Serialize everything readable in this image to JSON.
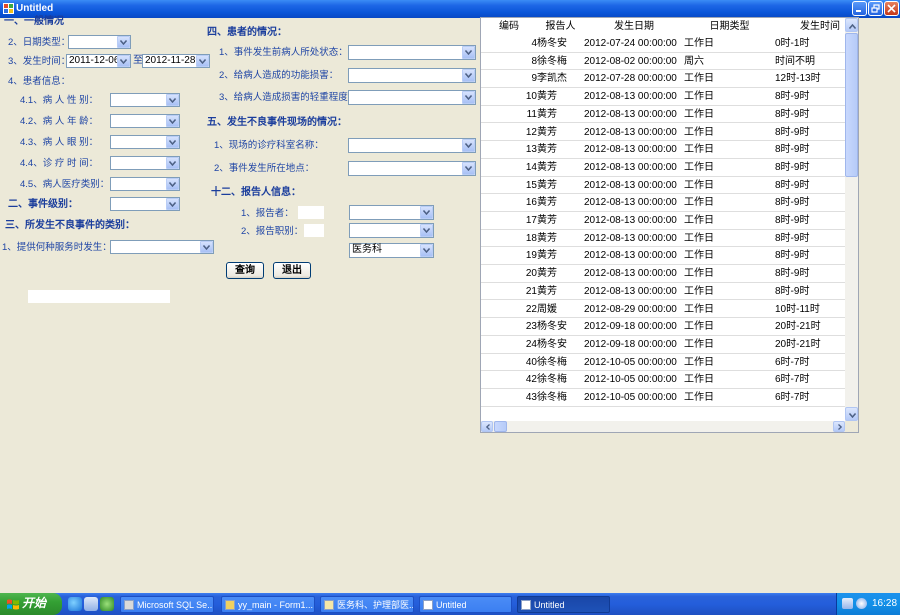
{
  "window": {
    "title": "Untitled",
    "app_icon": "app-window-icon"
  },
  "general": {
    "title": "一、一般情况",
    "date_type": {
      "label": "2、日期类型："
    },
    "occur_time": {
      "label": "3、发生时间：",
      "from": "2011-12-06",
      "sep": "至",
      "to": "2012-11-28"
    },
    "patient_info": {
      "label": "4、患者信息："
    },
    "patient_fields": [
      {
        "label": "4.1、病 人 性 别："
      },
      {
        "label": "4.2、病 人 年 龄："
      },
      {
        "label": "4.3、病 人 眼 别："
      },
      {
        "label": "4.4、诊 疗 时 间："
      },
      {
        "label": "4.5、病人医疗类别："
      }
    ]
  },
  "event_level": {
    "label": "二、事件级别："
  },
  "event_category": {
    "title": "三、所发生不良事件的类别：",
    "service": {
      "label": "1、提供何种服务时发生："
    }
  },
  "patient_status": {
    "title": "四、患者的情况：",
    "fields": [
      {
        "label": "1、事件发生前病人所处状态："
      },
      {
        "label": "2、给病人造成的功能损害："
      },
      {
        "label": "3、给病人造成损害的轻重程度："
      }
    ]
  },
  "scene": {
    "title": "五、发生不良事件现场的情况：",
    "fields": [
      {
        "label": "1、现场的诊疗科室名称："
      },
      {
        "label": "2、事件发生所在地点："
      }
    ]
  },
  "reporter": {
    "title": "十二、报告人信息：",
    "fields": [
      {
        "label": "1、报告者："
      },
      {
        "label": "2、报告职别："
      }
    ],
    "department": "医务科"
  },
  "buttons": {
    "query": "查询",
    "exit": "退出"
  },
  "grid": {
    "columns": [
      "编码",
      "报告人",
      "发生日期",
      "日期类型",
      "发生时间"
    ],
    "rows": [
      {
        "code": "4",
        "reporter": "杨冬安",
        "date": "2012-07-24 00:00:00",
        "type": "工作日",
        "time": "0时-1时"
      },
      {
        "code": "8",
        "reporter": "徐冬梅",
        "date": "2012-08-02 00:00:00",
        "type": "周六",
        "time": "时间不明"
      },
      {
        "code": "9",
        "reporter": "李凯杰",
        "date": "2012-07-28 00:00:00",
        "type": "工作日",
        "time": "12时-13时"
      },
      {
        "code": "10",
        "reporter": "黄芳",
        "date": "2012-08-13 00:00:00",
        "type": "工作日",
        "time": "8时-9时"
      },
      {
        "code": "11",
        "reporter": "黄芳",
        "date": "2012-08-13 00:00:00",
        "type": "工作日",
        "time": "8时-9时"
      },
      {
        "code": "12",
        "reporter": "黄芳",
        "date": "2012-08-13 00:00:00",
        "type": "工作日",
        "time": "8时-9时"
      },
      {
        "code": "13",
        "reporter": "黄芳",
        "date": "2012-08-13 00:00:00",
        "type": "工作日",
        "time": "8时-9时"
      },
      {
        "code": "14",
        "reporter": "黄芳",
        "date": "2012-08-13 00:00:00",
        "type": "工作日",
        "time": "8时-9时"
      },
      {
        "code": "15",
        "reporter": "黄芳",
        "date": "2012-08-13 00:00:00",
        "type": "工作日",
        "time": "8时-9时"
      },
      {
        "code": "16",
        "reporter": "黄芳",
        "date": "2012-08-13 00:00:00",
        "type": "工作日",
        "time": "8时-9时"
      },
      {
        "code": "17",
        "reporter": "黄芳",
        "date": "2012-08-13 00:00:00",
        "type": "工作日",
        "time": "8时-9时"
      },
      {
        "code": "18",
        "reporter": "黄芳",
        "date": "2012-08-13 00:00:00",
        "type": "工作日",
        "time": "8时-9时"
      },
      {
        "code": "19",
        "reporter": "黄芳",
        "date": "2012-08-13 00:00:00",
        "type": "工作日",
        "time": "8时-9时"
      },
      {
        "code": "20",
        "reporter": "黄芳",
        "date": "2012-08-13 00:00:00",
        "type": "工作日",
        "time": "8时-9时"
      },
      {
        "code": "21",
        "reporter": "黄芳",
        "date": "2012-08-13 00:00:00",
        "type": "工作日",
        "time": "8时-9时"
      },
      {
        "code": "22",
        "reporter": "周媛",
        "date": "2012-08-29 00:00:00",
        "type": "工作日",
        "time": "10时-11时"
      },
      {
        "code": "23",
        "reporter": "杨冬安",
        "date": "2012-09-18 00:00:00",
        "type": "工作日",
        "time": "20时-21时"
      },
      {
        "code": "24",
        "reporter": "杨冬安",
        "date": "2012-09-18 00:00:00",
        "type": "工作日",
        "time": "20时-21时"
      },
      {
        "code": "40",
        "reporter": "徐冬梅",
        "date": "2012-10-05 00:00:00",
        "type": "工作日",
        "time": "6时-7时"
      },
      {
        "code": "42",
        "reporter": "徐冬梅",
        "date": "2012-10-05 00:00:00",
        "type": "工作日",
        "time": "6时-7时"
      },
      {
        "code": "43",
        "reporter": "徐冬梅",
        "date": "2012-10-05 00:00:00",
        "type": "工作日",
        "time": "6时-7时"
      }
    ]
  },
  "taskbar": {
    "start": "开始",
    "quick_launch": [
      "ie-icon",
      "desktop-icon",
      "media-icon"
    ],
    "tasks": [
      {
        "label": "Microsoft SQL Se...",
        "icon": "sql-server-icon",
        "active": false
      },
      {
        "label": "yy_main - Form1...",
        "icon": "vb-project-icon",
        "active": false
      },
      {
        "label": "医务科、护理部医...",
        "icon": "document-icon",
        "active": false
      },
      {
        "label": "Untitled",
        "icon": "app-window-icon",
        "active": false
      },
      {
        "label": "Untitled",
        "icon": "app-window-icon",
        "active": true
      }
    ],
    "tray_icons": [
      "network-icon",
      "volume-icon"
    ],
    "clock": "16:28"
  },
  "colors": {
    "label": "#1f45a5",
    "titlebar": "#0a55d8",
    "taskbar": "#245edb",
    "start": "#34a034",
    "window_bg": "#ece9d8"
  }
}
